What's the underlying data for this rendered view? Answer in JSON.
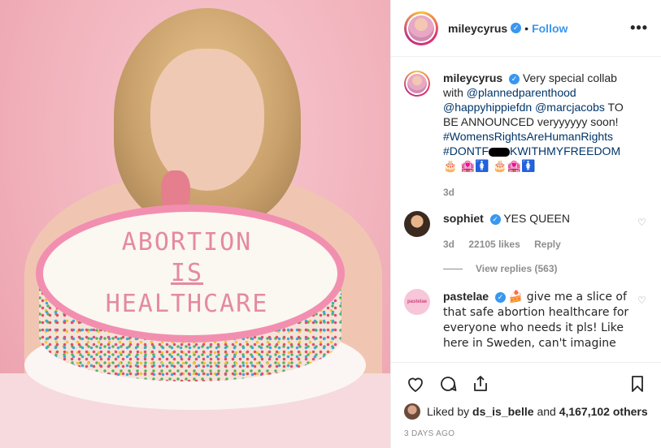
{
  "photo": {
    "cake_text": [
      "ABORTION",
      "IS",
      "HEALTHCARE"
    ]
  },
  "header": {
    "username": "mileycyrus",
    "separator": "•",
    "follow_label": "Follow",
    "more_icon": "more-horizontal-icon"
  },
  "caption": {
    "username": "mileycyrus",
    "text_intro": "Very special collab with",
    "mention_pp": "@plannedparenthood",
    "mention_hh": "@happyhippiefdn",
    "mention_mj": "@marcjacobs",
    "text_mid": "TO BE ANNOUNCED veryyyyyy soon!",
    "hashtag_1": "#WomensRightsAreHumanRights",
    "hashtag_2_start": "#DONTF",
    "hashtag_2_end": "KWITHMYFREEDOM",
    "emoji_line": "🎂 🏩🚺 🎂🏩🚺",
    "time": "3d"
  },
  "comments": [
    {
      "username": "sophiet",
      "text": "YES QUEEN",
      "time": "3d",
      "likes": "22105 likes",
      "reply": "Reply",
      "view_replies": "View replies (563)"
    },
    {
      "username": "pastelae",
      "text": "🍰 give me a slice of that safe abortion healthcare for everyone who needs it pls! Like here in Sweden, can't imagine",
      "avatar_label": "pastelae"
    }
  ],
  "actions": {
    "liked_by_prefix": "Liked by",
    "liked_by_user": "ds_is_belle",
    "liked_by_and": "and",
    "liked_by_count": "4,167,102 others",
    "timestamp": "3 DAYS AGO"
  },
  "colors": {
    "accent": "#3897f0",
    "link": "#003569",
    "muted": "#8e8e8e"
  }
}
